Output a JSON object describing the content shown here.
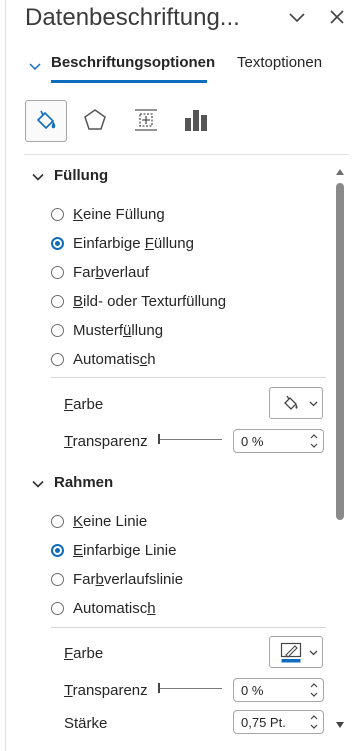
{
  "header": {
    "title": "Datenbeschriftung...",
    "collapse_icon": "chevron-down-icon",
    "close_icon": "close-icon"
  },
  "tabs": [
    {
      "label": "Beschriftungsoptionen",
      "active": true
    },
    {
      "label": "Textoptionen",
      "active": false
    }
  ],
  "category_icons": [
    {
      "name": "fill-line-icon",
      "selected": true
    },
    {
      "name": "effects-pentagon-icon",
      "selected": false
    },
    {
      "name": "size-properties-icon",
      "selected": false
    },
    {
      "name": "label-options-chart-icon",
      "selected": false
    }
  ],
  "fill_section": {
    "title": "Füllung",
    "options": [
      {
        "pre": "",
        "ul": "K",
        "post": "eine Füllung",
        "checked": false
      },
      {
        "pre": "Einfarbige ",
        "ul": "F",
        "post": "üllung",
        "checked": true
      },
      {
        "pre": "Far",
        "ul": "b",
        "post": "verlauf",
        "checked": false
      },
      {
        "pre": "",
        "ul": "B",
        "post": "ild- oder Texturfüllung",
        "checked": false
      },
      {
        "pre": "Musterf",
        "ul": "ü",
        "post": "llung",
        "checked": false
      },
      {
        "pre": "Automatis",
        "ul": "c",
        "post": "h",
        "checked": false
      }
    ],
    "color_label_ul": "F",
    "color_label_rest": "arbe",
    "transparency_label_ul": "T",
    "transparency_label_rest": "ransparenz",
    "transparency_value": "0 %",
    "transparency_level": 0
  },
  "border_section": {
    "title": "Rahmen",
    "options": [
      {
        "pre": "",
        "ul": "K",
        "post": "eine Linie",
        "checked": false
      },
      {
        "pre": "",
        "ul": "E",
        "post": "infarbige Linie",
        "checked": true
      },
      {
        "pre": "Far",
        "ul": "b",
        "post": "verlaufslinie",
        "checked": false
      },
      {
        "pre": "Automatisc",
        "ul": "h",
        "post": "",
        "checked": false
      }
    ],
    "color_label_ul": "F",
    "color_label_rest": "arbe",
    "transparency_label_ul": "T",
    "transparency_label_rest": "ransparenz",
    "transparency_value": "0 %",
    "transparency_level": 0,
    "width_label": "Stärke",
    "width_value": "0,75 Pt."
  },
  "accent_color": "#0f6cbd"
}
